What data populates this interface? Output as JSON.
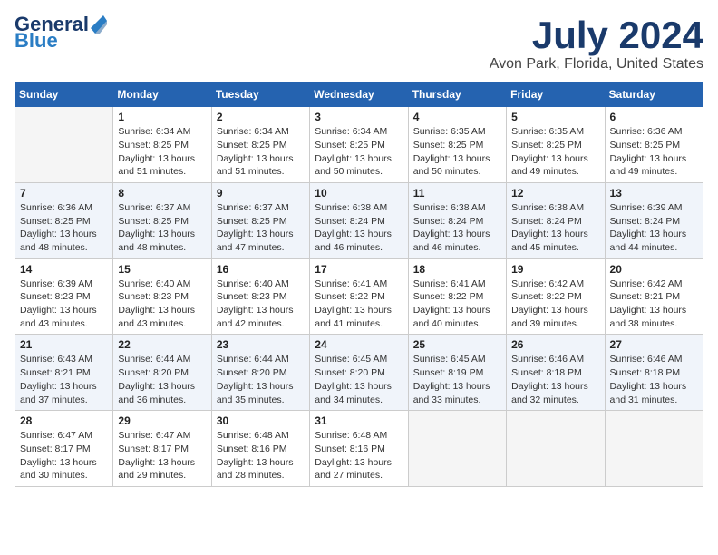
{
  "header": {
    "logo_line1": "General",
    "logo_line2": "Blue",
    "title": "July 2024",
    "subtitle": "Avon Park, Florida, United States"
  },
  "calendar": {
    "weekdays": [
      "Sunday",
      "Monday",
      "Tuesday",
      "Wednesday",
      "Thursday",
      "Friday",
      "Saturday"
    ],
    "weeks": [
      [
        {
          "day": null,
          "info": null
        },
        {
          "day": "1",
          "sunrise": "6:34 AM",
          "sunset": "8:25 PM",
          "daylight": "13 hours and 51 minutes."
        },
        {
          "day": "2",
          "sunrise": "6:34 AM",
          "sunset": "8:25 PM",
          "daylight": "13 hours and 51 minutes."
        },
        {
          "day": "3",
          "sunrise": "6:34 AM",
          "sunset": "8:25 PM",
          "daylight": "13 hours and 50 minutes."
        },
        {
          "day": "4",
          "sunrise": "6:35 AM",
          "sunset": "8:25 PM",
          "daylight": "13 hours and 50 minutes."
        },
        {
          "day": "5",
          "sunrise": "6:35 AM",
          "sunset": "8:25 PM",
          "daylight": "13 hours and 49 minutes."
        },
        {
          "day": "6",
          "sunrise": "6:36 AM",
          "sunset": "8:25 PM",
          "daylight": "13 hours and 49 minutes."
        }
      ],
      [
        {
          "day": "7",
          "sunrise": "6:36 AM",
          "sunset": "8:25 PM",
          "daylight": "13 hours and 48 minutes."
        },
        {
          "day": "8",
          "sunrise": "6:37 AM",
          "sunset": "8:25 PM",
          "daylight": "13 hours and 48 minutes."
        },
        {
          "day": "9",
          "sunrise": "6:37 AM",
          "sunset": "8:25 PM",
          "daylight": "13 hours and 47 minutes."
        },
        {
          "day": "10",
          "sunrise": "6:38 AM",
          "sunset": "8:24 PM",
          "daylight": "13 hours and 46 minutes."
        },
        {
          "day": "11",
          "sunrise": "6:38 AM",
          "sunset": "8:24 PM",
          "daylight": "13 hours and 46 minutes."
        },
        {
          "day": "12",
          "sunrise": "6:38 AM",
          "sunset": "8:24 PM",
          "daylight": "13 hours and 45 minutes."
        },
        {
          "day": "13",
          "sunrise": "6:39 AM",
          "sunset": "8:24 PM",
          "daylight": "13 hours and 44 minutes."
        }
      ],
      [
        {
          "day": "14",
          "sunrise": "6:39 AM",
          "sunset": "8:23 PM",
          "daylight": "13 hours and 43 minutes."
        },
        {
          "day": "15",
          "sunrise": "6:40 AM",
          "sunset": "8:23 PM",
          "daylight": "13 hours and 43 minutes."
        },
        {
          "day": "16",
          "sunrise": "6:40 AM",
          "sunset": "8:23 PM",
          "daylight": "13 hours and 42 minutes."
        },
        {
          "day": "17",
          "sunrise": "6:41 AM",
          "sunset": "8:22 PM",
          "daylight": "13 hours and 41 minutes."
        },
        {
          "day": "18",
          "sunrise": "6:41 AM",
          "sunset": "8:22 PM",
          "daylight": "13 hours and 40 minutes."
        },
        {
          "day": "19",
          "sunrise": "6:42 AM",
          "sunset": "8:22 PM",
          "daylight": "13 hours and 39 minutes."
        },
        {
          "day": "20",
          "sunrise": "6:42 AM",
          "sunset": "8:21 PM",
          "daylight": "13 hours and 38 minutes."
        }
      ],
      [
        {
          "day": "21",
          "sunrise": "6:43 AM",
          "sunset": "8:21 PM",
          "daylight": "13 hours and 37 minutes."
        },
        {
          "day": "22",
          "sunrise": "6:44 AM",
          "sunset": "8:20 PM",
          "daylight": "13 hours and 36 minutes."
        },
        {
          "day": "23",
          "sunrise": "6:44 AM",
          "sunset": "8:20 PM",
          "daylight": "13 hours and 35 minutes."
        },
        {
          "day": "24",
          "sunrise": "6:45 AM",
          "sunset": "8:20 PM",
          "daylight": "13 hours and 34 minutes."
        },
        {
          "day": "25",
          "sunrise": "6:45 AM",
          "sunset": "8:19 PM",
          "daylight": "13 hours and 33 minutes."
        },
        {
          "day": "26",
          "sunrise": "6:46 AM",
          "sunset": "8:18 PM",
          "daylight": "13 hours and 32 minutes."
        },
        {
          "day": "27",
          "sunrise": "6:46 AM",
          "sunset": "8:18 PM",
          "daylight": "13 hours and 31 minutes."
        }
      ],
      [
        {
          "day": "28",
          "sunrise": "6:47 AM",
          "sunset": "8:17 PM",
          "daylight": "13 hours and 30 minutes."
        },
        {
          "day": "29",
          "sunrise": "6:47 AM",
          "sunset": "8:17 PM",
          "daylight": "13 hours and 29 minutes."
        },
        {
          "day": "30",
          "sunrise": "6:48 AM",
          "sunset": "8:16 PM",
          "daylight": "13 hours and 28 minutes."
        },
        {
          "day": "31",
          "sunrise": "6:48 AM",
          "sunset": "8:16 PM",
          "daylight": "13 hours and 27 minutes."
        },
        {
          "day": null,
          "info": null
        },
        {
          "day": null,
          "info": null
        },
        {
          "day": null,
          "info": null
        }
      ]
    ],
    "labels": {
      "sunrise": "Sunrise:",
      "sunset": "Sunset:",
      "daylight": "Daylight:"
    }
  }
}
